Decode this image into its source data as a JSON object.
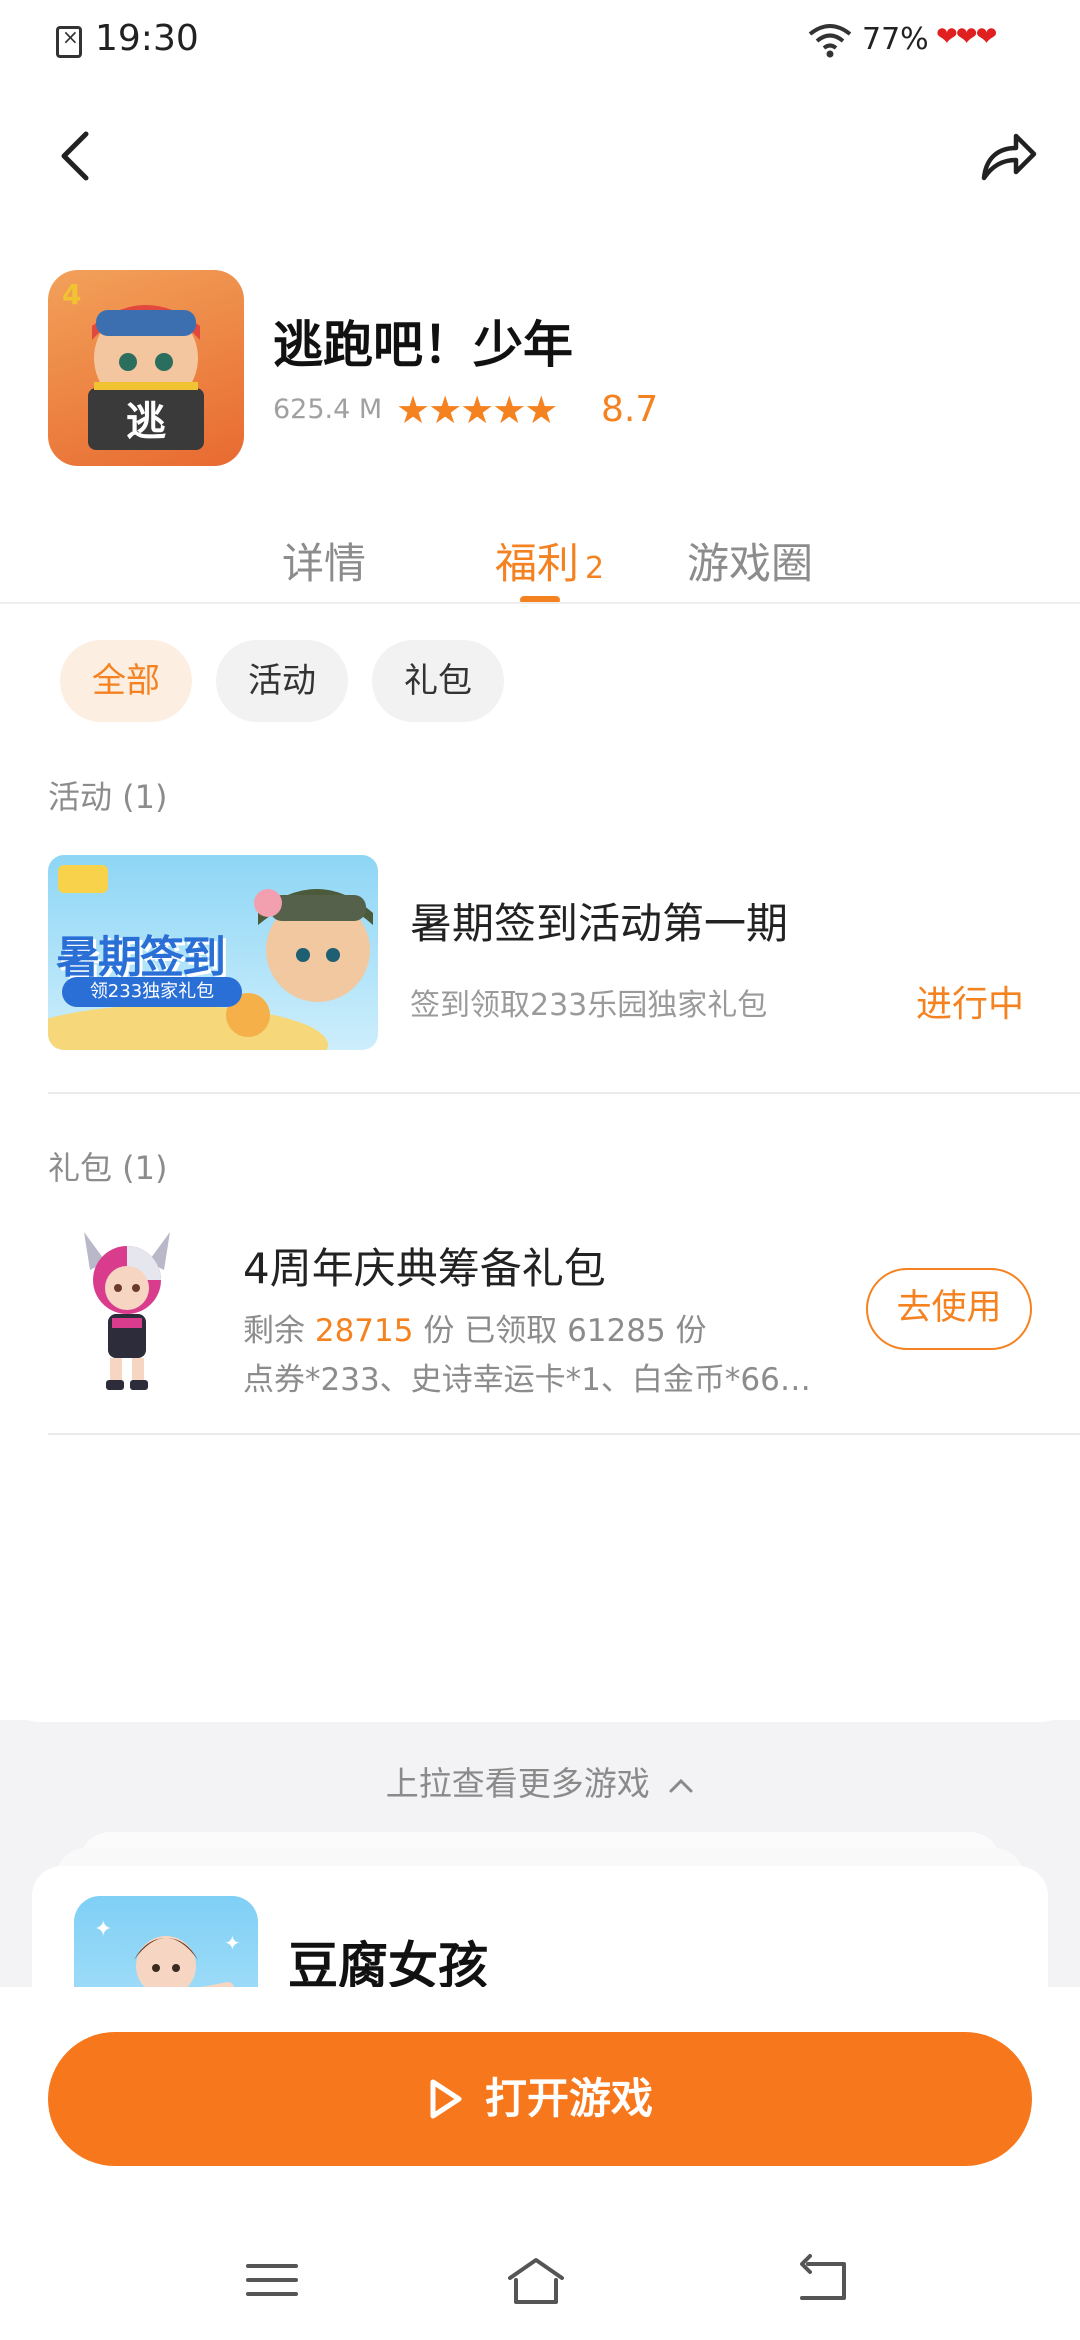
{
  "status": {
    "time": "19:30",
    "battery": "77%",
    "hearts": "❤❤❤"
  },
  "nav": {
    "back_icon": "chevron-left-icon",
    "share_icon": "share-icon"
  },
  "app": {
    "name": "逃跑吧！少年",
    "size": "625.4 M",
    "stars": "★★★★★",
    "rating": "8.7",
    "star_rating": 4.5
  },
  "tabs": [
    {
      "label": "详情"
    },
    {
      "label": "福利",
      "badge": "2"
    },
    {
      "label": "游戏圈"
    }
  ],
  "filters": [
    {
      "label": "全部"
    },
    {
      "label": "活动"
    },
    {
      "label": "礼包"
    }
  ],
  "events": {
    "header": "活动 (1)",
    "item": {
      "title": "暑期签到活动第一期",
      "subtitle": "签到领取233乐园独家礼包",
      "status": "进行中",
      "thumb_text": "暑期签到",
      "thumb_sub": "领233独家礼包"
    }
  },
  "gifts": {
    "header": "礼包 (1)",
    "item": {
      "title": "4周年庆典筹备礼包",
      "remaining_label": "剩余",
      "remaining": "28715",
      "unit1": "份 已领取",
      "claimed": "61285",
      "unit2": "份",
      "items": "点券*233、史诗幸运卡*1、白金币*66…",
      "button": "去使用"
    }
  },
  "more_games": "上拉查看更多游戏",
  "recommend": {
    "name": "豆腐女孩"
  },
  "primary_button": "打开游戏",
  "colors": {
    "accent": "#f58220",
    "button": "#f7771c",
    "chip_active_bg": "#fdeee2"
  }
}
